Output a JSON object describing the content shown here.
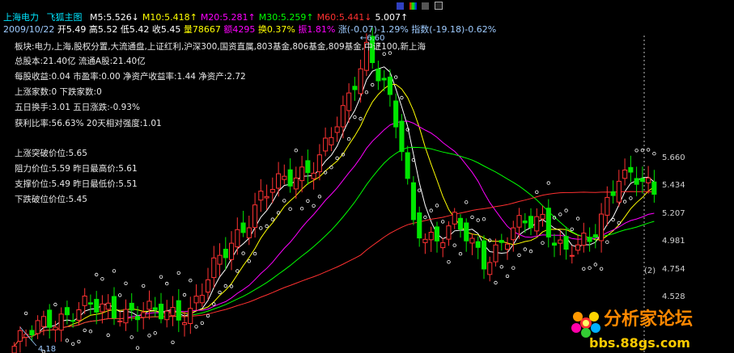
{
  "header": {
    "stock_name": "上海电力",
    "chart_mode": "飞狐主图",
    "ma": [
      {
        "label": "M5:5.526",
        "arrow": "↓",
        "color": "#ffffff"
      },
      {
        "label": "M10:5.418",
        "arrow": "↑",
        "color": "#ffff00"
      },
      {
        "label": "M20:5.281",
        "arrow": "↑",
        "color": "#ff00ff"
      },
      {
        "label": "M30:5.259",
        "arrow": "↑",
        "color": "#00ff00"
      },
      {
        "label": "M60:5.441",
        "arrow": "↓",
        "color": "#ff3030"
      },
      {
        "label": "5.007",
        "arrow": "↑",
        "color": "#ffffff"
      }
    ]
  },
  "quote": {
    "date": "2009/10/22",
    "open": "开5.49",
    "high": "高5.52",
    "low": "低5.42",
    "close": "收5.45",
    "volume": "量78667",
    "amount": "额4295",
    "turnover": "换0.37%",
    "amplitude": "振1.81%",
    "change": "涨(-0.07)-1.29%",
    "index": "指数(-19.18)-0.62%"
  },
  "info_panel": [
    "板块:电力,上海,股权分置,大流通盘,上证红利,沪深300,国资直属,803基金,806基金,809基金,中证100,新上海",
    "总股本:21.40亿 流通A股:21.40亿",
    "每股收益:0.04 市盈率:0.00 净资产收益率:1.44 净资产:2.72",
    "上涨家数:0   下跌家数:0",
    "五日换手:3.01  五日涨跌:-0.93%",
    "获利比率:56.63%  20天相对强度:1.01",
    "上涨突破价位:5.65",
    "阻力价位:5.59  昨日最高价:5.61",
    "支撑价位:5.49  昨日最低价:5.51",
    "下跌破位价位:5.45"
  ],
  "colors": {
    "background": "#000000",
    "up": "#ff3232",
    "down": "#00e600",
    "ma5": "#ffffff",
    "ma10": "#ffff00",
    "ma20": "#ff00ff",
    "ma30": "#00ff00",
    "ma60": "#ff3030",
    "sar": "#ffffff",
    "axis_text": "#d0d0d0"
  },
  "chart_data": {
    "type": "candlestick",
    "y_ticks": [
      "5.660",
      "5.434",
      "5.207",
      "4.981",
      "4.754",
      "4.528"
    ],
    "ylim": [
      4.3,
      6.65
    ],
    "peak_label": "6.60",
    "low_label": "4.18",
    "n_bars": 110,
    "anchors_close": [
      [
        0,
        4.35
      ],
      [
        6,
        4.55
      ],
      [
        12,
        4.63
      ],
      [
        18,
        4.62
      ],
      [
        24,
        4.58
      ],
      [
        30,
        4.62
      ],
      [
        36,
        5.05
      ],
      [
        42,
        5.45
      ],
      [
        48,
        5.62
      ],
      [
        52,
        5.75
      ],
      [
        56,
        6.05
      ],
      [
        60,
        6.58
      ],
      [
        63,
        6.3
      ],
      [
        66,
        5.8
      ],
      [
        68,
        5.25
      ],
      [
        72,
        5.15
      ],
      [
        75,
        5.25
      ],
      [
        80,
        5.0
      ],
      [
        85,
        5.2
      ],
      [
        90,
        5.3
      ],
      [
        94,
        5.05
      ],
      [
        98,
        5.1
      ],
      [
        103,
        5.65
      ],
      [
        107,
        5.55
      ],
      [
        109,
        5.45
      ]
    ],
    "ma_legend": [
      "M5",
      "M10",
      "M20",
      "M30",
      "M60"
    ],
    "right_marker": "(2)"
  },
  "watermark": {
    "name": "分析家论坛",
    "url": "bbs.88gs.com"
  }
}
